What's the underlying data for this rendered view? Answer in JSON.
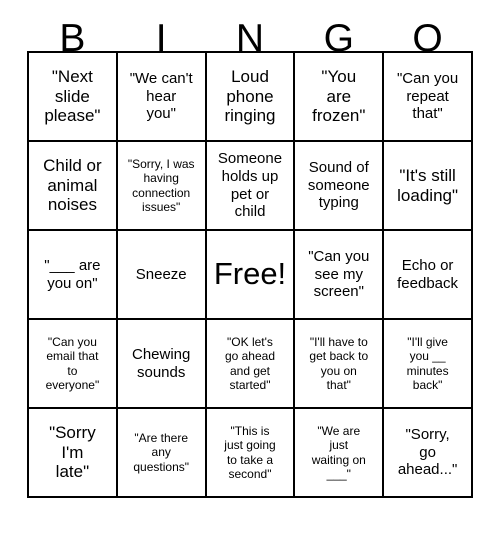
{
  "header": {
    "letters": [
      "B",
      "I",
      "N",
      "G",
      "O"
    ]
  },
  "grid": {
    "rows": 5,
    "columns": 5,
    "border_color": "#000000",
    "background_color": "#ffffff",
    "text_color": "#000000"
  },
  "cells": [
    {
      "text": "\"Next\nslide\nplease\"",
      "size": "lg",
      "free": false
    },
    {
      "text": "\"We can't\nhear\nyou\"",
      "size": "md",
      "free": false
    },
    {
      "text": "Loud\nphone\nringing",
      "size": "lg",
      "free": false
    },
    {
      "text": "\"You\nare\nfrozen\"",
      "size": "lg",
      "free": false
    },
    {
      "text": "\"Can you\nrepeat\nthat\"",
      "size": "md",
      "free": false
    },
    {
      "text": "Child or\nanimal\nnoises",
      "size": "lg",
      "free": false
    },
    {
      "text": "\"Sorry, I was\nhaving\nconnection\nissues\"",
      "size": "sm",
      "free": false
    },
    {
      "text": "Someone\nholds up\npet or\nchild",
      "size": "md",
      "free": false
    },
    {
      "text": "Sound of\nsomeone\ntyping",
      "size": "md",
      "free": false
    },
    {
      "text": "\"It's still\nloading\"",
      "size": "lg",
      "free": false
    },
    {
      "text": "\"___ are\nyou on\"",
      "size": "md",
      "free": false
    },
    {
      "text": "Sneeze",
      "size": "md",
      "free": false
    },
    {
      "text": "Free!",
      "size": "free",
      "free": true
    },
    {
      "text": "\"Can you\nsee my\nscreen\"",
      "size": "md",
      "free": false
    },
    {
      "text": "Echo or\nfeedback",
      "size": "md",
      "free": false
    },
    {
      "text": "\"Can you\nemail that\nto\neveryone\"",
      "size": "sm",
      "free": false
    },
    {
      "text": "Chewing\nsounds",
      "size": "md",
      "free": false
    },
    {
      "text": "\"OK let's\ngo ahead\nand get\nstarted\"",
      "size": "sm",
      "free": false
    },
    {
      "text": "\"I'll have to\nget back to\nyou on\nthat\"",
      "size": "sm",
      "free": false
    },
    {
      "text": "\"I'll give\nyou __\nminutes\nback\"",
      "size": "sm",
      "free": false
    },
    {
      "text": "\"Sorry\nI'm\nlate\"",
      "size": "lg",
      "free": false
    },
    {
      "text": "\"Are there\nany\nquestions\"",
      "size": "sm",
      "free": false
    },
    {
      "text": "\"This is\njust going\nto take a\nsecond\"",
      "size": "sm",
      "free": false
    },
    {
      "text": "\"We are\njust\nwaiting on\n___\"",
      "size": "sm",
      "free": false
    },
    {
      "text": "\"Sorry,\ngo\nahead...\"",
      "size": "md",
      "free": false
    }
  ]
}
